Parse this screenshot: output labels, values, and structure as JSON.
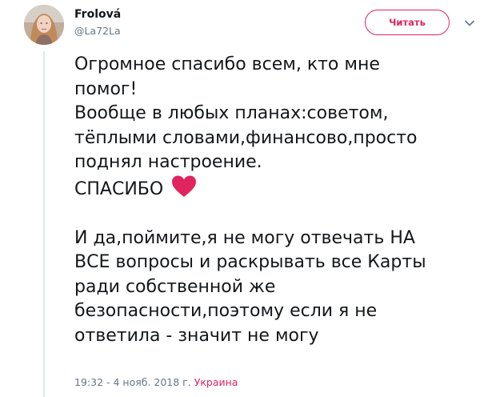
{
  "author": {
    "name": "Frolová",
    "handle": "@La72La",
    "avatar_icon": "profile-photo-avatar"
  },
  "follow_button": {
    "label": "Читать",
    "color": "#e0245e"
  },
  "menu_icon": "chevron-down-icon",
  "tweet": {
    "paragraph_1_lines": "Огромное спасибо всем, кто мне\nпомог!\nВообще в любых планах:советом,\nтёплыми словами,финансово,просто\nподнял настроение.",
    "thanks": "СПАСИБО",
    "thanks_emoji": "red-heart-icon",
    "paragraph_2": "И да,поймите,я не могу отвечать НА\nВСЕ вопросы и раскрывать все Карты\nради собственной же\nбезопасности,поэтому если я не\nответила - значит не могу"
  },
  "meta": {
    "timestamp": "19:32 - 4 нояб. 2018 г.",
    "location": "Украина"
  },
  "colors": {
    "text": "#14171a",
    "secondary_text": "#657786",
    "accent": "#e0245e",
    "thread_line": "#e1e8ed"
  }
}
